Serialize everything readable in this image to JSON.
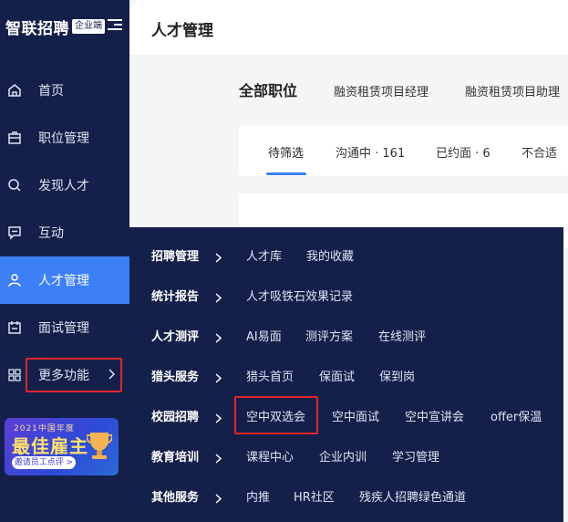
{
  "brand": {
    "name": "智联招聘",
    "tag": "企业端"
  },
  "sidebar": {
    "items": [
      {
        "label": "首页",
        "icon": "home-icon"
      },
      {
        "label": "职位管理",
        "icon": "briefcase-icon"
      },
      {
        "label": "发现人才",
        "icon": "search-icon"
      },
      {
        "label": "互动",
        "icon": "chat-icon"
      },
      {
        "label": "人才管理",
        "icon": "user-icon",
        "active": true
      },
      {
        "label": "面试管理",
        "icon": "calendar-icon"
      },
      {
        "label": "更多功能",
        "icon": "grid-icon"
      }
    ]
  },
  "banner": {
    "year": "2021中国年度",
    "title": "最佳雇主",
    "button": "邀请员工点评 >"
  },
  "header": {
    "title": "人才管理"
  },
  "positions": {
    "tabs": [
      "全部职位",
      "融资租赁项目经理",
      "融资租赁项目助理"
    ]
  },
  "status_tabs": [
    "待筛选",
    "沟通中 · 161",
    "已约面 · 6",
    "不合适"
  ],
  "flyout": {
    "rows": [
      {
        "category": "招聘管理",
        "links": [
          "人才库",
          "我的收藏"
        ]
      },
      {
        "category": "统计报告",
        "links": [
          "人才吸铁石效果记录"
        ]
      },
      {
        "category": "人才测评",
        "links": [
          "AI易面",
          "测评方案",
          "在线测评"
        ]
      },
      {
        "category": "猎头服务",
        "links": [
          "猎头首页",
          "保面试",
          "保到岗"
        ]
      },
      {
        "category": "校园招聘",
        "links": [
          "空中双选会",
          "空中面试",
          "空中宣讲会",
          "offer保温"
        ]
      },
      {
        "category": "教育培训",
        "links": [
          "课程中心",
          "企业内训",
          "学习管理"
        ]
      },
      {
        "category": "其他服务",
        "links": [
          "内推",
          "HR社区",
          "残疾人招聘绿色通道"
        ]
      }
    ]
  },
  "colors": {
    "sidebar_bg": "#14204a",
    "accent": "#3d7ff6",
    "highlight": "#e0252b"
  }
}
